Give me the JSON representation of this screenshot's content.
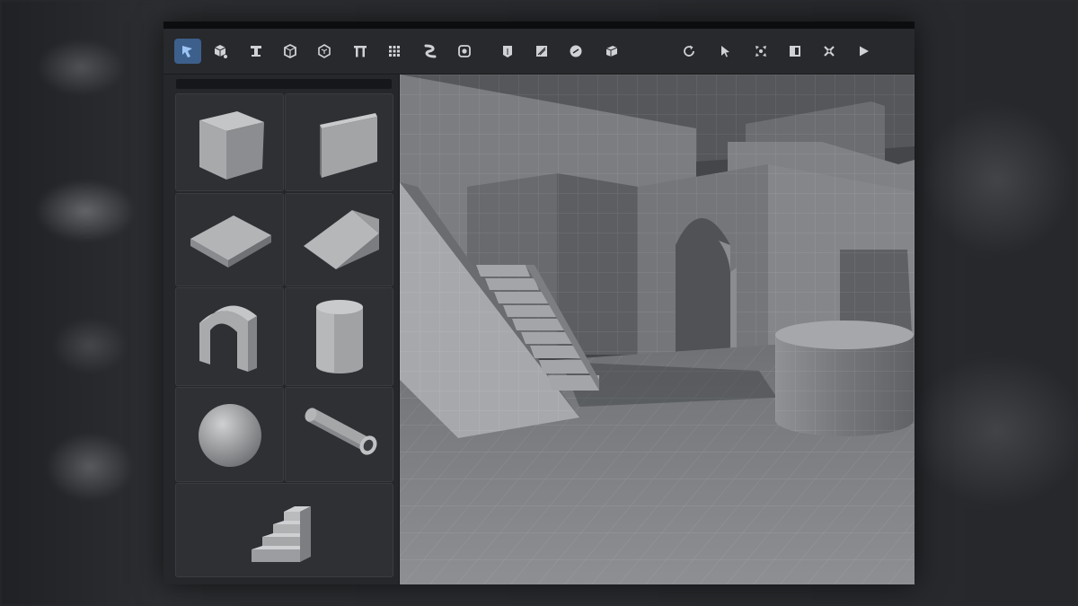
{
  "toolbar": {
    "left_tools": [
      {
        "icon": "select-tool-icon",
        "active": true
      },
      {
        "icon": "cube-add-icon"
      },
      {
        "icon": "column-icon"
      },
      {
        "icon": "box-icon"
      },
      {
        "icon": "hex-box-icon"
      },
      {
        "icon": "pillars-icon"
      },
      {
        "icon": "grid-icon"
      },
      {
        "icon": "curve-icon"
      },
      {
        "icon": "shape-icon"
      },
      {
        "icon": "wall-icon"
      },
      {
        "icon": "texture-icon"
      },
      {
        "icon": "sphere-icon"
      },
      {
        "icon": "package-icon"
      }
    ],
    "right_tools": [
      {
        "icon": "rotate-icon"
      },
      {
        "icon": "pointer-icon"
      },
      {
        "icon": "move-icon"
      },
      {
        "icon": "panel-icon"
      },
      {
        "icon": "transform-icon"
      },
      {
        "icon": "play-icon"
      }
    ]
  },
  "accent_color": "#3d5f8c",
  "primitives": [
    {
      "name": "cube"
    },
    {
      "name": "wall"
    },
    {
      "name": "floor"
    },
    {
      "name": "ramp"
    },
    {
      "name": "arch"
    },
    {
      "name": "cylinder"
    },
    {
      "name": "sphere"
    },
    {
      "name": "pipe"
    },
    {
      "name": "stairs"
    }
  ]
}
